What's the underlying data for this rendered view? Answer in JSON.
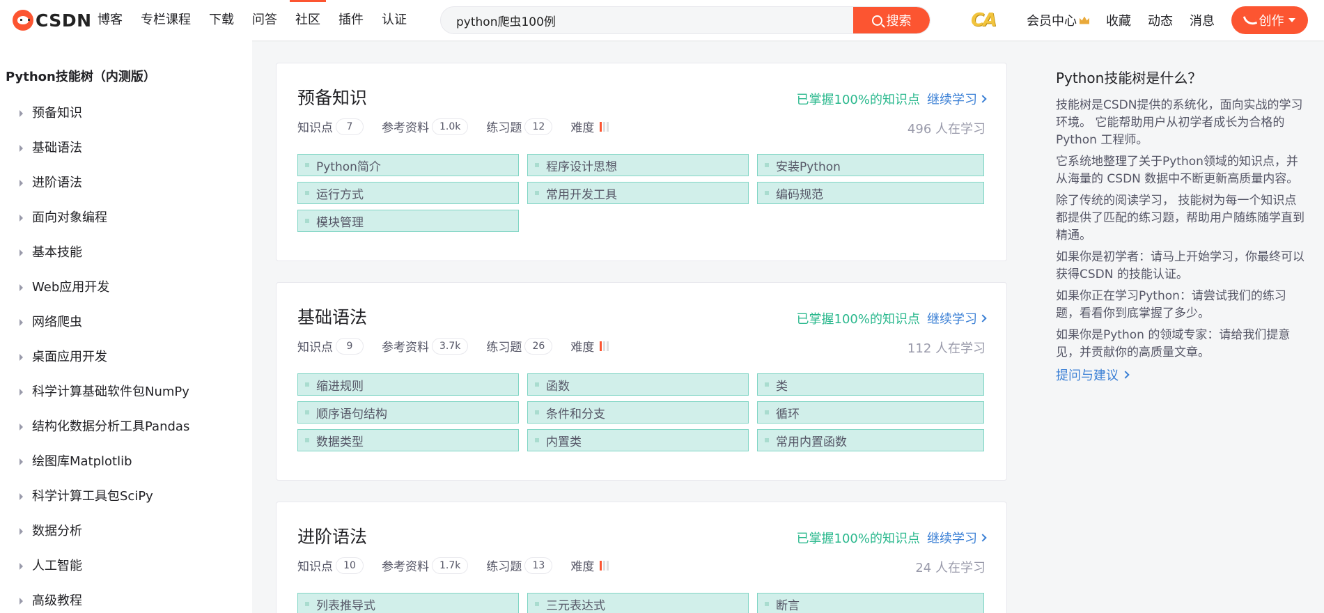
{
  "header": {
    "logo_text": "CSDN",
    "nav": [
      "博客",
      "专栏课程",
      "下载",
      "问答",
      "社区",
      "插件",
      "认证"
    ],
    "active_nav": "社区",
    "search_value": "python爬虫100例",
    "search_button": "搜索",
    "badge": "CA",
    "right_nav": [
      "会员中心",
      "收藏",
      "动态",
      "消息"
    ],
    "create_button": "创作"
  },
  "sidebar": {
    "title": "Python技能树（内测版）",
    "items": [
      "预备知识",
      "基础语法",
      "进阶语法",
      "面向对象编程",
      "基本技能",
      "Web应用开发",
      "网络爬虫",
      "桌面应用开发",
      "科学计算基础软件包NumPy",
      "结构化数据分析工具Pandas",
      "绘图库Matplotlib",
      "科学计算工具包SciPy",
      "数据分析",
      "人工智能",
      "高级教程"
    ]
  },
  "labels": {
    "points": "知识点",
    "references": "参考资料",
    "exercises": "练习题",
    "difficulty": "难度",
    "mastered": "已掌握100%的知识点",
    "continue": "继续学习"
  },
  "cards": [
    {
      "title": "预备知识",
      "points": "7",
      "references": "1.0k",
      "exercises": "12",
      "difficulty": 1,
      "learners": "496 人在学习",
      "topics": [
        "Python简介",
        "程序设计思想",
        "安装Python",
        "运行方式",
        "常用开发工具",
        "编码规范",
        "模块管理"
      ]
    },
    {
      "title": "基础语法",
      "points": "9",
      "references": "3.7k",
      "exercises": "26",
      "difficulty": 1,
      "learners": "112 人在学习",
      "topics": [
        "缩进规则",
        "函数",
        "类",
        "顺序语句结构",
        "条件和分支",
        "循环",
        "数据类型",
        "内置类",
        "常用内置函数"
      ]
    },
    {
      "title": "进阶语法",
      "points": "10",
      "references": "1.7k",
      "exercises": "13",
      "difficulty": 1,
      "learners": "24 人在学习",
      "topics": [
        "列表推导式",
        "三元表达式",
        "断言"
      ]
    }
  ],
  "info": {
    "title": "Python技能树是什么？",
    "paragraphs": [
      "技能树是CSDN提供的系统化，面向实战的学习环境。 它能帮助用户从初学者成长为合格的 Python 工程师。",
      "它系统地整理了关于Python领域的知识点，并从海量的 CSDN 数据中不断更新高质量内容。",
      "除了传统的阅读学习， 技能树为每一个知识点都提供了匹配的练习题，帮助用户随练随学直到精通。",
      "如果你是初学者：请马上开始学习，你最终可以获得CSDN 的技能认证。",
      "如果你正在学习Python：请尝试我们的练习题，看看你到底掌握了多少。",
      "如果你是Python 的领域专家：请给我们提意见，并贡献你的高质量文章。"
    ],
    "link": "提问与建议"
  },
  "colors": {
    "brand": "#fc5531",
    "topic_bg": "#d1efea",
    "mastered": "#2ab88d",
    "link": "#3a7fd5"
  }
}
